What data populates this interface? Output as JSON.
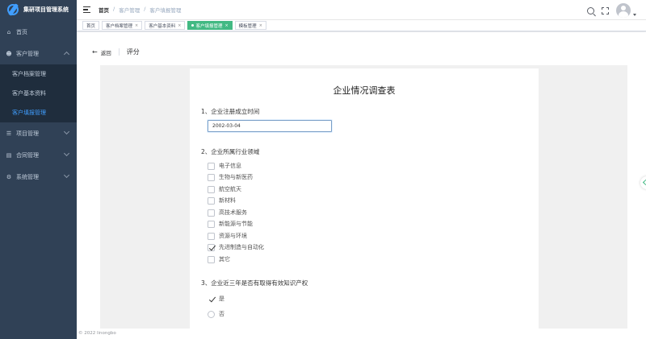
{
  "app": {
    "title": "集研项目管理系统"
  },
  "sidebar": {
    "items": [
      {
        "label": "首页",
        "icon": "home-icon"
      },
      {
        "label": "客户管理",
        "icon": "user-icon",
        "expanded": true,
        "children": [
          {
            "label": "客户档案管理"
          },
          {
            "label": "客户基本资料"
          },
          {
            "label": "客户填报管理",
            "active": true
          }
        ]
      },
      {
        "label": "项目管理",
        "icon": "list-icon"
      },
      {
        "label": "合同管理",
        "icon": "book-icon"
      },
      {
        "label": "系统管理",
        "icon": "gear-icon"
      }
    ]
  },
  "breadcrumb": [
    "首页",
    "客户管理",
    "客户填报管理"
  ],
  "tags": [
    {
      "label": "首页",
      "closable": false
    },
    {
      "label": "客户档案管理",
      "closable": true
    },
    {
      "label": "客户基本资料",
      "closable": true
    },
    {
      "label": "客户填报管理",
      "closable": true,
      "active": true
    },
    {
      "label": "模板管理",
      "closable": true
    }
  ],
  "page": {
    "back_label": "返回",
    "title": "评分"
  },
  "form": {
    "title": "企业情况调查表",
    "q1": {
      "label": "1、企业注册成立时间",
      "value": "2002-03-04"
    },
    "q2": {
      "label": "2、企业所属行业领域",
      "options": [
        {
          "label": "电子信息",
          "checked": false
        },
        {
          "label": "生物与新医药",
          "checked": false
        },
        {
          "label": "航空航天",
          "checked": false
        },
        {
          "label": "新材料",
          "checked": false
        },
        {
          "label": "高技术服务",
          "checked": false
        },
        {
          "label": "新能源与节能",
          "checked": false
        },
        {
          "label": "资源与环境",
          "checked": false
        },
        {
          "label": "先进制造与自动化",
          "checked": true
        },
        {
          "label": "其它",
          "checked": false
        }
      ]
    },
    "q3": {
      "label": "3、企业近三年是否有取得有效知识产权",
      "options": [
        {
          "label": "是",
          "checked": true
        },
        {
          "label": "否",
          "checked": false
        }
      ]
    }
  },
  "footer": {
    "copyright": "© 2022 linongbo"
  },
  "colors": {
    "sidebar_bg": "#304156",
    "active_menu": "#409eff",
    "active_tag": "#42b983"
  }
}
